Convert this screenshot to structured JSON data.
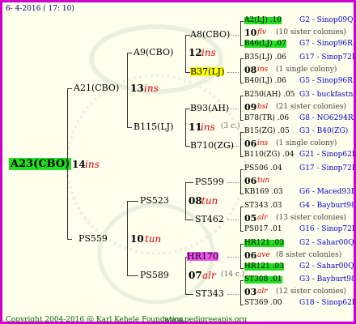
{
  "header": {
    "date": "6- 4-2016 ( 17: 10)"
  },
  "root": {
    "name": "A23(CBO)",
    "num": "14",
    "tag": "ins"
  },
  "gen1": [
    {
      "name": "A21(CBO)",
      "num": "13",
      "tag": "ins"
    },
    {
      "name": "PS559",
      "num": "10",
      "tag": "tun"
    }
  ],
  "gen2": [
    {
      "name": "A9(CBO)",
      "num": "12",
      "tag": "ins"
    },
    {
      "name": "B115(LJ)",
      "num": "11",
      "tag": "ins",
      "note": "(3 c.)"
    },
    {
      "name": "PS523",
      "num": "08",
      "tag": "tun"
    },
    {
      "name": "PS589",
      "num": "07",
      "tag": "alr",
      "note": "(14 c.)"
    }
  ],
  "gen3": [
    {
      "name": "A8(CBO)"
    },
    {
      "name": "B37(LJ)"
    },
    {
      "name": "B93(AH)"
    },
    {
      "name": "B710(ZG)"
    },
    {
      "name": "PS599"
    },
    {
      "name": "ST462"
    },
    {
      "name": "HR170"
    },
    {
      "name": "ST343"
    }
  ],
  "gen4": [
    {
      "top": "A2(LJ) .10",
      "top_src": "G2 - Sinop09Q",
      "num": "10",
      "tag": "flv",
      "note": "(10 sister colonies)",
      "bot": "B46(LJ) .07",
      "bot_src": "G7 - Sinop96R"
    },
    {
      "top": "B35(LJ) .06",
      "top_src": "G17 - Sinop72R",
      "num": "08",
      "tag": "ins",
      "note": "(1 single colony)",
      "bot": "B40(LJ) .06",
      "bot_src": "G5 - Sinop96R"
    },
    {
      "top": "B250(AH) .05",
      "top_src": "G3 - buckfastno",
      "num": "09",
      "tag": "bsl",
      "note": "(21 sister colonies)",
      "bot": "B78(TR) .06",
      "bot_src": "G8 - NO6294R"
    },
    {
      "top": "B15(ZG) .05",
      "top_src": "G3 - B40(ZG)",
      "num": "06",
      "tag": "ins",
      "note": "(1 single colony)",
      "bot": "B110(ZG) .04",
      "bot_src": "G21 - Sinop62R"
    },
    {
      "top": "PS506 .04",
      "top_src": "G17 - Sinop72R",
      "num": "06",
      "tag": "tun",
      "note": "",
      "bot": "KB169 .03",
      "bot_src": "G6 - Maced93R"
    },
    {
      "top": "ST343 .03",
      "top_src": "G4 - Bayburt98-3",
      "num": "05",
      "tag": "alr",
      "note": "(13 sister colonies)",
      "bot": "PS017 .01",
      "bot_src": "G16 - Sinop72R"
    },
    {
      "top": "HR121 .03",
      "top_src": "G2 - Sahar00Q",
      "num": "06",
      "tag": "ave",
      "note": "(8 sister colonies)",
      "bot": "HR121 .03",
      "bot_src": "G2 - Sahar00Q"
    },
    {
      "top": "ST308 .01",
      "top_src": "G3 - Bayburt98-3",
      "num": "03",
      "tag": "alr",
      "note": "(12 sister colonies)",
      "bot": "ST369 .00",
      "bot_src": "G18 - Sinop62R"
    }
  ],
  "footer": {
    "copyright": "Copyright 2004-2016 @ Karl Kehele Foundation.",
    "site": "www.pedigreeapis.org"
  }
}
